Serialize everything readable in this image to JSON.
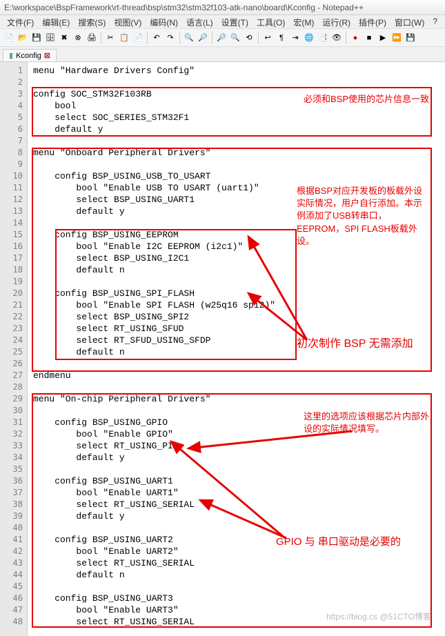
{
  "title": "E:\\workspace\\BspFramework\\rt-thread\\bsp\\stm32\\stm32f103-atk-nano\\board\\Kconfig - Notepad++",
  "menus": [
    "文件(F)",
    "编辑(E)",
    "搜索(S)",
    "视图(V)",
    "编码(N)",
    "语言(L)",
    "设置(T)",
    "工具(O)",
    "宏(M)",
    "运行(R)",
    "插件(P)",
    "窗口(W)",
    "?"
  ],
  "tab": {
    "name": "Kconfig"
  },
  "line_numbers": [
    "1",
    "2",
    "3",
    "4",
    "5",
    "6",
    "7",
    "8",
    "9",
    "10",
    "11",
    "12",
    "13",
    "14",
    "15",
    "16",
    "17",
    "18",
    "19",
    "20",
    "21",
    "22",
    "23",
    "24",
    "25",
    "26",
    "27",
    "28",
    "29",
    "30",
    "31",
    "32",
    "33",
    "34",
    "35",
    "36",
    "37",
    "38",
    "39",
    "40",
    "41",
    "42",
    "43",
    "44",
    "45",
    "46",
    "47",
    "48"
  ],
  "code": [
    "menu \"Hardware Drivers Config\"",
    "",
    "config SOC_STM32F103RB",
    "    bool",
    "    select SOC_SERIES_STM32F1",
    "    default y",
    "",
    "menu \"Onboard Peripheral Drivers\"",
    "",
    "    config BSP_USING_USB_TO_USART",
    "        bool \"Enable USB TO USART (uart1)\"",
    "        select BSP_USING_UART1",
    "        default y",
    "",
    "    config BSP_USING_EEPROM",
    "        bool \"Enable I2C EEPROM (i2c1)\"",
    "        select BSP_USING_I2C1",
    "        default n",
    "",
    "    config BSP_USING_SPI_FLASH",
    "        bool \"Enable SPI FLASH (w25q16 spi2)\"",
    "        select BSP_USING_SPI2",
    "        select RT_USING_SFUD",
    "        select RT_SFUD_USING_SFDP",
    "        default n",
    "",
    "endmenu",
    "",
    "menu \"On-chip Peripheral Drivers\"",
    "",
    "    config BSP_USING_GPIO",
    "        bool \"Enable GPIO\"",
    "        select RT_USING_PIN",
    "        default y",
    "",
    "    config BSP_USING_UART1",
    "        bool \"Enable UART1\"",
    "        select RT_USING_SERIAL",
    "        default y",
    "",
    "    config BSP_USING_UART2",
    "        bool \"Enable UART2\"",
    "        select RT_USING_SERIAL",
    "        default n",
    "",
    "    config BSP_USING_UART3",
    "        bool \"Enable UART3\"",
    "        select RT_USING_SERIAL"
  ],
  "annotations": {
    "a1": "必须和BSP使用的芯片信息一致",
    "a2": "根据BSP对应开发板的板载外设实际情况，用户自行添加。本示例添加了USB转串口，EEPROM，SPI FLASH板载外设。",
    "a3": "初次制作 BSP 无需添加",
    "a4": "这里的选项应该根据芯片内部外设的实际情况填写。",
    "a5": "GPIO 与 串口驱动是必要的"
  },
  "watermark": "https://blog.cs @51CTO博客",
  "toolbar_icons": [
    "new",
    "open",
    "save",
    "save-all",
    "close",
    "close-all",
    "print",
    "cut",
    "copy",
    "paste",
    "undo",
    "redo",
    "find",
    "replace",
    "zoom-in",
    "zoom-out",
    "wrap",
    "show-all",
    "indent",
    "lang",
    "monitor",
    "record",
    "play",
    "rec2",
    "play2"
  ]
}
